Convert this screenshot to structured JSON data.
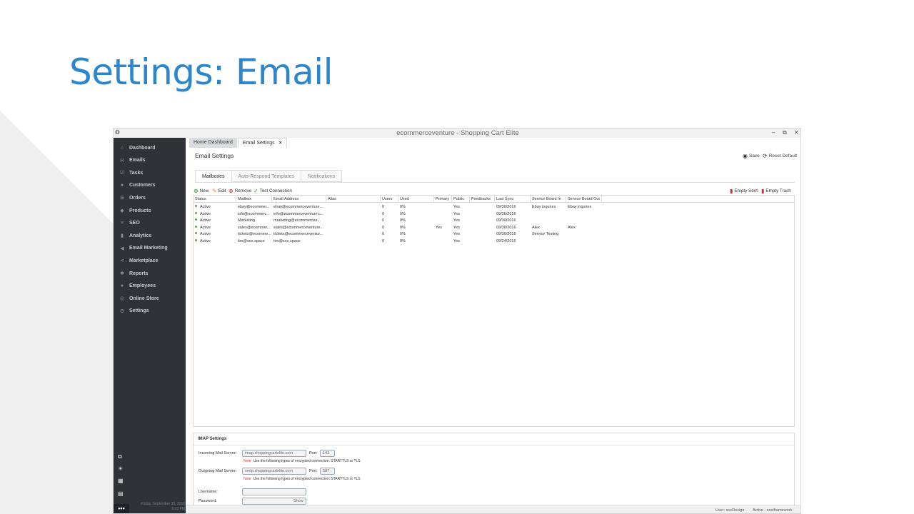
{
  "slide": {
    "title": "Settings: Email"
  },
  "window": {
    "title": "ecommerceventure - Shopping Cart Elite",
    "controls": {
      "minimize": "–",
      "restore": "⧉",
      "close": "✕"
    }
  },
  "sidebar": {
    "items": [
      {
        "label": "Dashboard",
        "icon": "home-icon",
        "glyph": "⌂"
      },
      {
        "label": "Emails",
        "icon": "envelope-icon",
        "glyph": "✉"
      },
      {
        "label": "Tasks",
        "icon": "tasks-icon",
        "glyph": "☑"
      },
      {
        "label": "Customers",
        "icon": "user-icon",
        "glyph": "●"
      },
      {
        "label": "Orders",
        "icon": "cart-icon",
        "glyph": "⊞"
      },
      {
        "label": "Products",
        "icon": "tag-icon",
        "glyph": "◆"
      },
      {
        "label": "SEO",
        "icon": "seo-icon",
        "glyph": "≡"
      },
      {
        "label": "Analytics",
        "icon": "bar-chart-icon",
        "glyph": "▮"
      },
      {
        "label": "Email Marketing",
        "icon": "megaphone-icon",
        "glyph": "◀"
      },
      {
        "label": "Marketplace",
        "icon": "share-icon",
        "glyph": "⋖"
      },
      {
        "label": "Reports",
        "icon": "gear-icon",
        "glyph": "✱"
      },
      {
        "label": "Employees",
        "icon": "group-icon",
        "glyph": "●"
      },
      {
        "label": "Online Store",
        "icon": "globe-icon",
        "glyph": "◎"
      },
      {
        "label": "Settings",
        "icon": "search-gear-icon",
        "glyph": "⚙"
      }
    ],
    "bottom_icons": [
      {
        "icon": "windows-icon",
        "glyph": "⧉"
      },
      {
        "icon": "lightbulb-icon",
        "glyph": "☀"
      },
      {
        "icon": "calculator-icon",
        "glyph": "▦"
      },
      {
        "icon": "calendar-icon",
        "glyph": "▤"
      }
    ],
    "date": "Friday, September 30, 2016",
    "time": "5:23 PM",
    "more": "•••"
  },
  "doc_tabs": [
    {
      "label": "Home Dashboard"
    },
    {
      "label": "Email Settings",
      "close": "×"
    }
  ],
  "page": {
    "heading": "Email Settings",
    "save_label": "Save",
    "reset_label": "Reset Default"
  },
  "sub_tabs": [
    {
      "label": "Mailboxes"
    },
    {
      "label": "Auto-Respond Templates"
    },
    {
      "label": "Notifications"
    }
  ],
  "toolbar": {
    "new_label": "New",
    "edit_label": "Edit",
    "remove_label": "Remove",
    "test_label": "Test Connection",
    "empty_sent_label": "Empty Sent",
    "empty_trash_label": "Empty Trash"
  },
  "grid": {
    "columns": [
      "Status",
      "Mailbox",
      "Email Address",
      "Alias",
      "Users",
      "Used",
      "Primary",
      "Public",
      "Feedbacks",
      "Last Sync",
      "Service Board In",
      "Service Board Out"
    ],
    "rows": [
      [
        "Active",
        "ebay@ecommer...",
        "ebay@ecommerceventure...",
        "",
        "0",
        "0%",
        "",
        "Yes",
        "",
        "09/30/2016",
        "Ebay inquires",
        "Ebay inquires"
      ],
      [
        "Active",
        "info@ecommerc...",
        "info@ecommerceventure.c...",
        "",
        "0",
        "0%",
        "",
        "Yes",
        "",
        "09/30/2016",
        "",
        ""
      ],
      [
        "Active",
        "Marketing",
        "marketing@ecommercee...",
        "",
        "0",
        "0%",
        "",
        "Yes",
        "",
        "09/30/2016",
        "",
        ""
      ],
      [
        "Active",
        "sales@ecommer...",
        "sales@ecommerceventure...",
        "",
        "0",
        "0%",
        "Yes",
        "Yes",
        "",
        "09/30/2016",
        "Alex",
        "Alex"
      ],
      [
        "Active",
        "tickets@ecomme...",
        "tickets@ecommerceventur...",
        "",
        "0",
        "0%",
        "",
        "Yes",
        "",
        "09/30/2016",
        "Service Testing",
        ""
      ],
      [
        "Active",
        "tim@sce.space",
        "tim@sce.space",
        "",
        "0",
        "0%",
        "",
        "Yes",
        "",
        "09/24/2016",
        "",
        ""
      ]
    ]
  },
  "imap": {
    "title": "IMAP Settings",
    "incoming_label": "Incoming Mail Server:",
    "incoming_value": "imap.shoppingcartelite.com",
    "incoming_port_label": "Port:",
    "incoming_port": "143",
    "incoming_note_key": "Note",
    "incoming_note": "Use the following types of encrypted connection: STARTTLS or TLS",
    "outgoing_label": "Outgoing Mail Server:",
    "outgoing_value": "smtp.shoppingcartelite.com",
    "outgoing_port_label": "Port:",
    "outgoing_port": "587",
    "outgoing_note_key": "Note",
    "outgoing_note": "Use the following types of encrypted connection: STARTTLS or TLS",
    "username_label": "Username:",
    "username_value": "",
    "password_label": "Password:",
    "password_value": "",
    "show_label": "Show"
  },
  "status": {
    "user": "User: sceDesign",
    "active": "Active - scelframework"
  }
}
